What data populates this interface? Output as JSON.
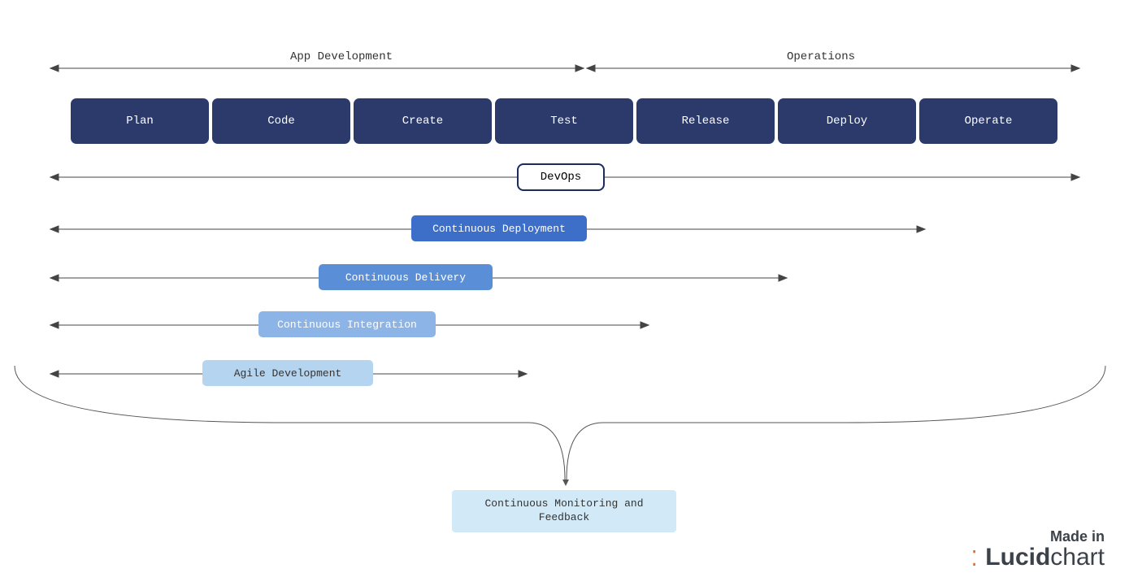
{
  "header": {
    "app_dev": "App Development",
    "operations": "Operations"
  },
  "phases": [
    {
      "label": "Plan"
    },
    {
      "label": "Code"
    },
    {
      "label": "Create"
    },
    {
      "label": "Test"
    },
    {
      "label": "Release"
    },
    {
      "label": "Deploy"
    },
    {
      "label": "Operate"
    }
  ],
  "spans": {
    "devops": "DevOps",
    "continuous_deployment": "Continuous Deployment",
    "continuous_delivery": "Continuous Delivery",
    "continuous_integration": "Continuous Integration",
    "agile_development": "Agile Development"
  },
  "footer_box": "Continuous Monitoring and Feedback",
  "brand": {
    "made_in": "Made in",
    "name_bold": "Lucid",
    "name_light": "chart"
  }
}
